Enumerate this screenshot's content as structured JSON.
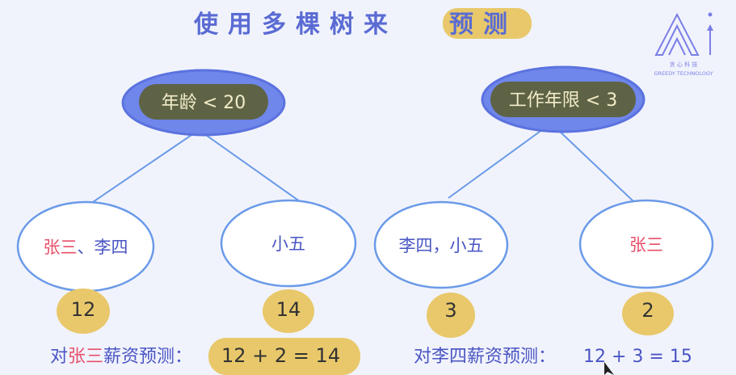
{
  "title": {
    "main": "使用多棵树来",
    "highlight": "预测"
  },
  "logo": {
    "cn": "贪 心 科 技",
    "en": "GREEDY TECHNOLOGY"
  },
  "colors": {
    "accent_blue": "#5a6bd3",
    "node_border": "#6a9ae8",
    "root_fill": "#6f86ea",
    "pill": "#5e6346",
    "yellow": "#e8c86a",
    "red": "#e8506a"
  },
  "trees": [
    {
      "root": "年龄  < 20",
      "left": {
        "label_red": "张三",
        "label_rest": "、李四",
        "value": "12"
      },
      "right": {
        "label": "小五",
        "value": "14"
      }
    },
    {
      "root": "工作年限 < 3",
      "left": {
        "label": "李四，小五",
        "value": "3"
      },
      "right": {
        "label_red": "张三",
        "value": "2"
      }
    }
  ],
  "predictions": [
    {
      "prefix": "对",
      "name": "张三",
      "suffix": "薪资预测：",
      "expr": "12 + 2 = 14"
    },
    {
      "prefix": "对李四薪资预测：",
      "expr": "12 + 3 = 15"
    }
  ]
}
